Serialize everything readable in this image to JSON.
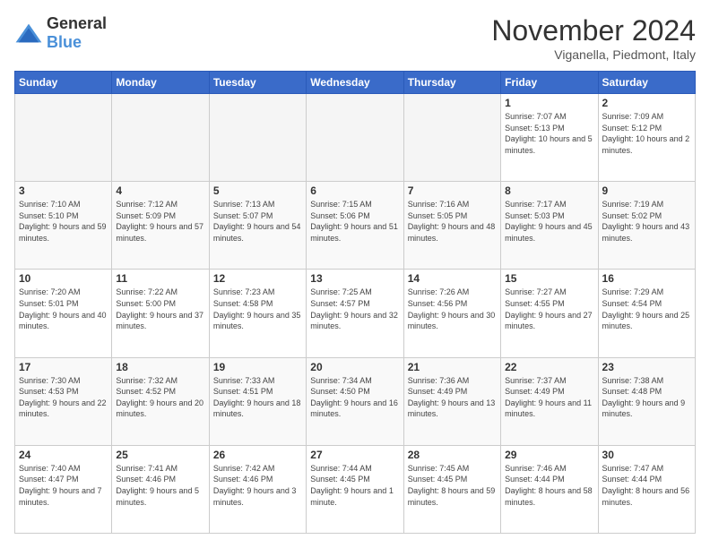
{
  "header": {
    "logo_general": "General",
    "logo_blue": "Blue",
    "month_title": "November 2024",
    "location": "Viganella, Piedmont, Italy"
  },
  "days_of_week": [
    "Sunday",
    "Monday",
    "Tuesday",
    "Wednesday",
    "Thursday",
    "Friday",
    "Saturday"
  ],
  "weeks": [
    [
      {
        "day": "",
        "empty": true
      },
      {
        "day": "",
        "empty": true
      },
      {
        "day": "",
        "empty": true
      },
      {
        "day": "",
        "empty": true
      },
      {
        "day": "",
        "empty": true
      },
      {
        "day": "1",
        "sunrise": "Sunrise: 7:07 AM",
        "sunset": "Sunset: 5:13 PM",
        "daylight": "Daylight: 10 hours and 5 minutes."
      },
      {
        "day": "2",
        "sunrise": "Sunrise: 7:09 AM",
        "sunset": "Sunset: 5:12 PM",
        "daylight": "Daylight: 10 hours and 2 minutes."
      }
    ],
    [
      {
        "day": "3",
        "sunrise": "Sunrise: 7:10 AM",
        "sunset": "Sunset: 5:10 PM",
        "daylight": "Daylight: 9 hours and 59 minutes."
      },
      {
        "day": "4",
        "sunrise": "Sunrise: 7:12 AM",
        "sunset": "Sunset: 5:09 PM",
        "daylight": "Daylight: 9 hours and 57 minutes."
      },
      {
        "day": "5",
        "sunrise": "Sunrise: 7:13 AM",
        "sunset": "Sunset: 5:07 PM",
        "daylight": "Daylight: 9 hours and 54 minutes."
      },
      {
        "day": "6",
        "sunrise": "Sunrise: 7:15 AM",
        "sunset": "Sunset: 5:06 PM",
        "daylight": "Daylight: 9 hours and 51 minutes."
      },
      {
        "day": "7",
        "sunrise": "Sunrise: 7:16 AM",
        "sunset": "Sunset: 5:05 PM",
        "daylight": "Daylight: 9 hours and 48 minutes."
      },
      {
        "day": "8",
        "sunrise": "Sunrise: 7:17 AM",
        "sunset": "Sunset: 5:03 PM",
        "daylight": "Daylight: 9 hours and 45 minutes."
      },
      {
        "day": "9",
        "sunrise": "Sunrise: 7:19 AM",
        "sunset": "Sunset: 5:02 PM",
        "daylight": "Daylight: 9 hours and 43 minutes."
      }
    ],
    [
      {
        "day": "10",
        "sunrise": "Sunrise: 7:20 AM",
        "sunset": "Sunset: 5:01 PM",
        "daylight": "Daylight: 9 hours and 40 minutes."
      },
      {
        "day": "11",
        "sunrise": "Sunrise: 7:22 AM",
        "sunset": "Sunset: 5:00 PM",
        "daylight": "Daylight: 9 hours and 37 minutes."
      },
      {
        "day": "12",
        "sunrise": "Sunrise: 7:23 AM",
        "sunset": "Sunset: 4:58 PM",
        "daylight": "Daylight: 9 hours and 35 minutes."
      },
      {
        "day": "13",
        "sunrise": "Sunrise: 7:25 AM",
        "sunset": "Sunset: 4:57 PM",
        "daylight": "Daylight: 9 hours and 32 minutes."
      },
      {
        "day": "14",
        "sunrise": "Sunrise: 7:26 AM",
        "sunset": "Sunset: 4:56 PM",
        "daylight": "Daylight: 9 hours and 30 minutes."
      },
      {
        "day": "15",
        "sunrise": "Sunrise: 7:27 AM",
        "sunset": "Sunset: 4:55 PM",
        "daylight": "Daylight: 9 hours and 27 minutes."
      },
      {
        "day": "16",
        "sunrise": "Sunrise: 7:29 AM",
        "sunset": "Sunset: 4:54 PM",
        "daylight": "Daylight: 9 hours and 25 minutes."
      }
    ],
    [
      {
        "day": "17",
        "sunrise": "Sunrise: 7:30 AM",
        "sunset": "Sunset: 4:53 PM",
        "daylight": "Daylight: 9 hours and 22 minutes."
      },
      {
        "day": "18",
        "sunrise": "Sunrise: 7:32 AM",
        "sunset": "Sunset: 4:52 PM",
        "daylight": "Daylight: 9 hours and 20 minutes."
      },
      {
        "day": "19",
        "sunrise": "Sunrise: 7:33 AM",
        "sunset": "Sunset: 4:51 PM",
        "daylight": "Daylight: 9 hours and 18 minutes."
      },
      {
        "day": "20",
        "sunrise": "Sunrise: 7:34 AM",
        "sunset": "Sunset: 4:50 PM",
        "daylight": "Daylight: 9 hours and 16 minutes."
      },
      {
        "day": "21",
        "sunrise": "Sunrise: 7:36 AM",
        "sunset": "Sunset: 4:49 PM",
        "daylight": "Daylight: 9 hours and 13 minutes."
      },
      {
        "day": "22",
        "sunrise": "Sunrise: 7:37 AM",
        "sunset": "Sunset: 4:49 PM",
        "daylight": "Daylight: 9 hours and 11 minutes."
      },
      {
        "day": "23",
        "sunrise": "Sunrise: 7:38 AM",
        "sunset": "Sunset: 4:48 PM",
        "daylight": "Daylight: 9 hours and 9 minutes."
      }
    ],
    [
      {
        "day": "24",
        "sunrise": "Sunrise: 7:40 AM",
        "sunset": "Sunset: 4:47 PM",
        "daylight": "Daylight: 9 hours and 7 minutes."
      },
      {
        "day": "25",
        "sunrise": "Sunrise: 7:41 AM",
        "sunset": "Sunset: 4:46 PM",
        "daylight": "Daylight: 9 hours and 5 minutes."
      },
      {
        "day": "26",
        "sunrise": "Sunrise: 7:42 AM",
        "sunset": "Sunset: 4:46 PM",
        "daylight": "Daylight: 9 hours and 3 minutes."
      },
      {
        "day": "27",
        "sunrise": "Sunrise: 7:44 AM",
        "sunset": "Sunset: 4:45 PM",
        "daylight": "Daylight: 9 hours and 1 minute."
      },
      {
        "day": "28",
        "sunrise": "Sunrise: 7:45 AM",
        "sunset": "Sunset: 4:45 PM",
        "daylight": "Daylight: 8 hours and 59 minutes."
      },
      {
        "day": "29",
        "sunrise": "Sunrise: 7:46 AM",
        "sunset": "Sunset: 4:44 PM",
        "daylight": "Daylight: 8 hours and 58 minutes."
      },
      {
        "day": "30",
        "sunrise": "Sunrise: 7:47 AM",
        "sunset": "Sunset: 4:44 PM",
        "daylight": "Daylight: 8 hours and 56 minutes."
      }
    ]
  ]
}
